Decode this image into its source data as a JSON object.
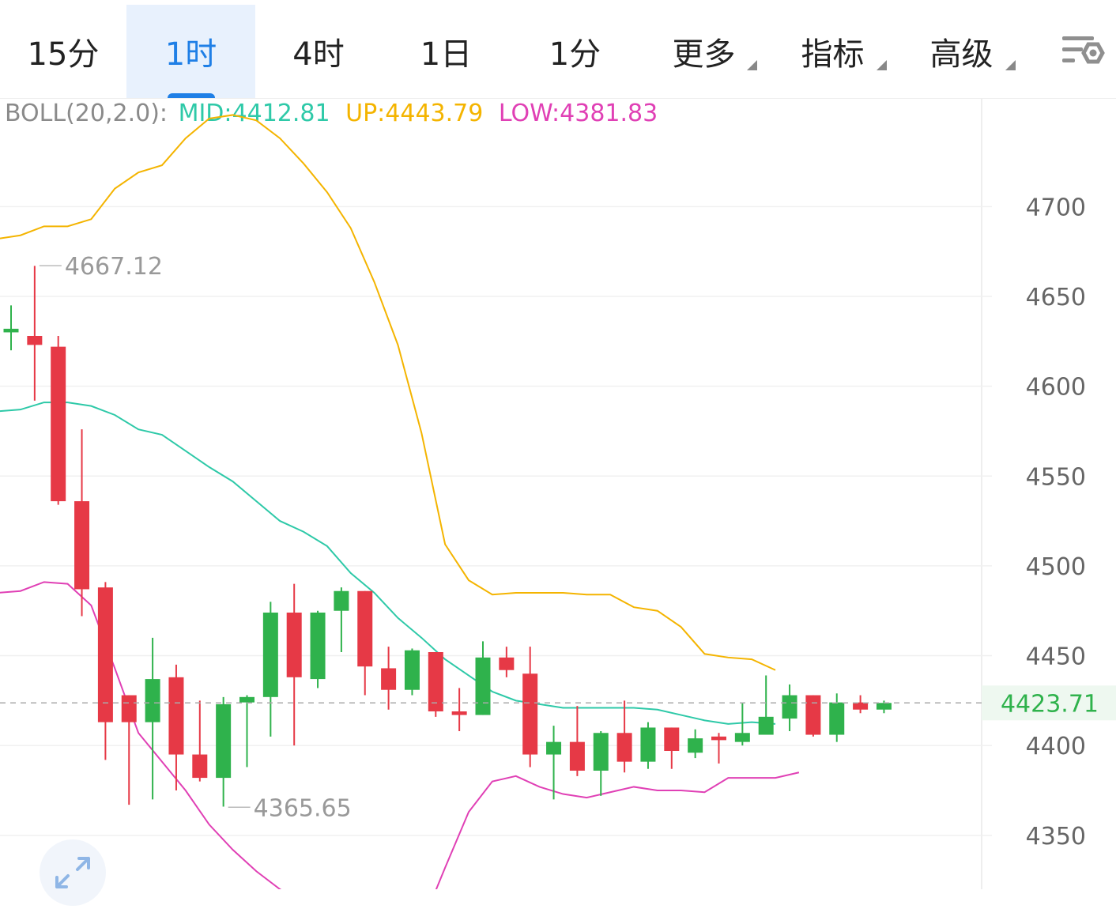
{
  "tabs": [
    {
      "label": "15分"
    },
    {
      "label": "1时",
      "active": true
    },
    {
      "label": "4时"
    },
    {
      "label": "1日"
    },
    {
      "label": "1分"
    },
    {
      "label": "更多",
      "dropdown": true
    },
    {
      "label": "指标",
      "dropdown": true
    },
    {
      "label": "高级",
      "dropdown": true
    }
  ],
  "icons": {
    "settings": "chart-settings-icon",
    "expand": "expand-icon"
  },
  "indicator": {
    "name": "BOLL(20,2.0):",
    "mid_label": "MID:4412.81",
    "up_label": "UP:4443.79",
    "low_label": "LOW:4381.83"
  },
  "colors": {
    "accent": "#1f7fe6",
    "up": "#e63946",
    "down": "#2fb24c",
    "mid": "#2ec9a8",
    "upper": "#f4b400",
    "lower": "#e040b5",
    "name": "#8a8a8a",
    "grid": "#f0f0f0",
    "axis_text": "#666666"
  },
  "chart_data": {
    "type": "candlestick",
    "ylim": [
      4320,
      4760
    ],
    "yticks": [
      4350,
      4400,
      4450,
      4500,
      4550,
      4600,
      4650,
      4700
    ],
    "current_price": {
      "value": 4423.71,
      "label": "4423.71"
    },
    "annotations": [
      {
        "label": "4667.12",
        "value": 4667.12,
        "index": 1
      },
      {
        "label": "4365.65",
        "value": 4365.65,
        "index": 9
      }
    ],
    "candles": [
      {
        "o": 4630,
        "h": 4645,
        "l": 4620,
        "c": 4632
      },
      {
        "o": 4628,
        "h": 4667,
        "l": 4592,
        "c": 4623
      },
      {
        "o": 4622,
        "h": 4628,
        "l": 4534,
        "c": 4536
      },
      {
        "o": 4536,
        "h": 4576,
        "l": 4472,
        "c": 4487
      },
      {
        "o": 4488,
        "h": 4491,
        "l": 4392,
        "c": 4413
      },
      {
        "o": 4428,
        "h": 4428,
        "l": 4367,
        "c": 4413
      },
      {
        "o": 4413,
        "h": 4460,
        "l": 4370,
        "c": 4437
      },
      {
        "o": 4438,
        "h": 4445,
        "l": 4375,
        "c": 4395
      },
      {
        "o": 4395,
        "h": 4425,
        "l": 4380,
        "c": 4382
      },
      {
        "o": 4382,
        "h": 4427,
        "l": 4366,
        "c": 4423
      },
      {
        "o": 4424,
        "h": 4428,
        "l": 4388,
        "c": 4427
      },
      {
        "o": 4427,
        "h": 4480,
        "l": 4405,
        "c": 4474
      },
      {
        "o": 4474,
        "h": 4490,
        "l": 4400,
        "c": 4438
      },
      {
        "o": 4437,
        "h": 4475,
        "l": 4432,
        "c": 4474
      },
      {
        "o": 4475,
        "h": 4488,
        "l": 4452,
        "c": 4486
      },
      {
        "o": 4486,
        "h": 4486,
        "l": 4428,
        "c": 4444
      },
      {
        "o": 4443,
        "h": 4455,
        "l": 4420,
        "c": 4431
      },
      {
        "o": 4431,
        "h": 4454,
        "l": 4428,
        "c": 4453
      },
      {
        "o": 4452,
        "h": 4452,
        "l": 4416,
        "c": 4419
      },
      {
        "o": 4419,
        "h": 4432,
        "l": 4408,
        "c": 4417
      },
      {
        "o": 4417,
        "h": 4458,
        "l": 4417,
        "c": 4449
      },
      {
        "o": 4449,
        "h": 4455,
        "l": 4438,
        "c": 4442
      },
      {
        "o": 4440,
        "h": 4455,
        "l": 4388,
        "c": 4395
      },
      {
        "o": 4395,
        "h": 4411,
        "l": 4370,
        "c": 4402
      },
      {
        "o": 4402,
        "h": 4422,
        "l": 4383,
        "c": 4386
      },
      {
        "o": 4386,
        "h": 4408,
        "l": 4372,
        "c": 4407
      },
      {
        "o": 4407,
        "h": 4425,
        "l": 4385,
        "c": 4391
      },
      {
        "o": 4391,
        "h": 4413,
        "l": 4387,
        "c": 4410
      },
      {
        "o": 4410,
        "h": 4410,
        "l": 4387,
        "c": 4397
      },
      {
        "o": 4396,
        "h": 4409,
        "l": 4393,
        "c": 4404
      },
      {
        "o": 4405,
        "h": 4407,
        "l": 4390,
        "c": 4403
      },
      {
        "o": 4402,
        "h": 4424,
        "l": 4400,
        "c": 4407
      },
      {
        "o": 4406,
        "h": 4439,
        "l": 4406,
        "c": 4416
      },
      {
        "o": 4415,
        "h": 4434,
        "l": 4408,
        "c": 4428
      },
      {
        "o": 4428,
        "h": 4428,
        "l": 4405,
        "c": 4406
      },
      {
        "o": 4406,
        "h": 4429,
        "l": 4402,
        "c": 4424
      },
      {
        "o": 4424,
        "h": 4428,
        "l": 4418,
        "c": 4420
      },
      {
        "o": 4420,
        "h": 4425,
        "l": 4418,
        "c": 4423.71
      }
    ],
    "series": [
      {
        "values": [
          4682,
          4684,
          4689,
          4689,
          4693,
          4710,
          4719,
          4723,
          4738,
          4749,
          4751,
          4748,
          4738,
          4724,
          4708,
          4688,
          4658,
          4623,
          4574,
          4512,
          4492,
          4484,
          4485,
          4485,
          4485,
          4484,
          4484,
          4477,
          4475,
          4466,
          4451,
          4449,
          4448,
          4442
        ]
      },
      {
        "values": [
          4586,
          4587,
          4591,
          4591,
          4589,
          4584,
          4576,
          4573,
          4564,
          4555,
          4547,
          4536,
          4525,
          4519,
          4511,
          4496,
          4485,
          4471,
          4460,
          4448,
          4439,
          4430,
          4425,
          4423,
          4421,
          4421,
          4421,
          4421,
          4420,
          4417,
          4414,
          4412,
          4413,
          4412
        ]
      },
      {
        "values": [
          4485,
          4486,
          4491,
          4490,
          4478,
          4443,
          4407,
          4391,
          4375,
          4356,
          4342,
          4330,
          4320,
          4312,
          4298,
          4299,
          4301,
          4299,
          4300,
          4332,
          4363,
          4380,
          4383,
          4377,
          4373,
          4371,
          4374,
          4377,
          4375,
          4375,
          4374,
          4382,
          4382,
          4382,
          4385
        ]
      }
    ]
  }
}
